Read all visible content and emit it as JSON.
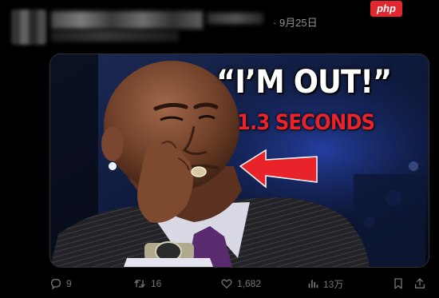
{
  "header": {
    "date": "· 9月25日",
    "watermark": "php"
  },
  "media": {
    "headline_quote": "“I’M OUT!”",
    "headline_sub": "1.3 SECONDS",
    "colors": {
      "headline": "#ffffff",
      "sub": "#e8232a",
      "arrow": "#e8232a"
    }
  },
  "actions": {
    "replies": "9",
    "reposts": "16",
    "likes": "1,682",
    "views": "13万"
  },
  "icons": [
    "reply-icon",
    "repost-icon",
    "like-icon",
    "views-icon",
    "bookmark-icon",
    "share-icon"
  ]
}
